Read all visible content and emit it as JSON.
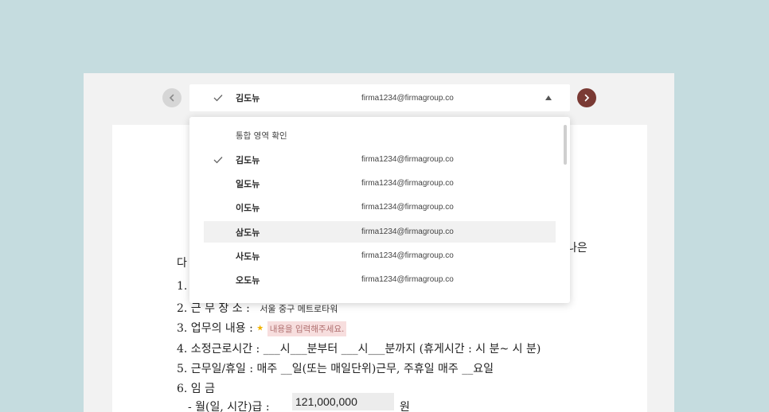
{
  "selector": {
    "name": "김도뉴",
    "email": "firma1234@firmagroup.co"
  },
  "dropdown": {
    "heading": "통합 영역 확인",
    "items": [
      {
        "name": "김도뉴",
        "email": "firma1234@firmagroup.co",
        "selected": true
      },
      {
        "name": "일도뉴",
        "email": "firma1234@firmagroup.co"
      },
      {
        "name": "이도뉴",
        "email": "firma1234@firmagroup.co"
      },
      {
        "name": "삼도뉴",
        "email": "firma1234@firmagroup.co",
        "highlighted": true
      },
      {
        "name": "사도뉴",
        "email": "firma1234@firmagroup.co"
      },
      {
        "name": "오도뉴",
        "email": "firma1234@firmagroup.co"
      }
    ]
  },
  "document": {
    "fragment_right": "나은",
    "fragment_left": "다",
    "item1_num": "1.",
    "item2_label": "2. 근 무 장 소 :",
    "item2_value": "서울 중구 메트로타워",
    "item3_label": "3. 업무의 내용 :",
    "item3_placeholder": "내용을 입력해주세요.",
    "item4": "4. 소정근로시간 : ___시___분부터 ___시___분까지 (휴게시간 : 시 분~ 시 분)",
    "item5": "5. 근무일/휴일 : 매주 __일(또는 매일단위)근무, 주휴일 매주 __요일",
    "item6": "6. 임 금",
    "wage_label": "- 월(일, 시간)급 :",
    "wage_value": "121,000,000",
    "wage_unit": "원"
  },
  "colors": {
    "background": "#c5dcdf",
    "next_button": "#7a3a34",
    "highlight_row": "#f1f1f1",
    "placeholder_bg": "#f7dede"
  }
}
